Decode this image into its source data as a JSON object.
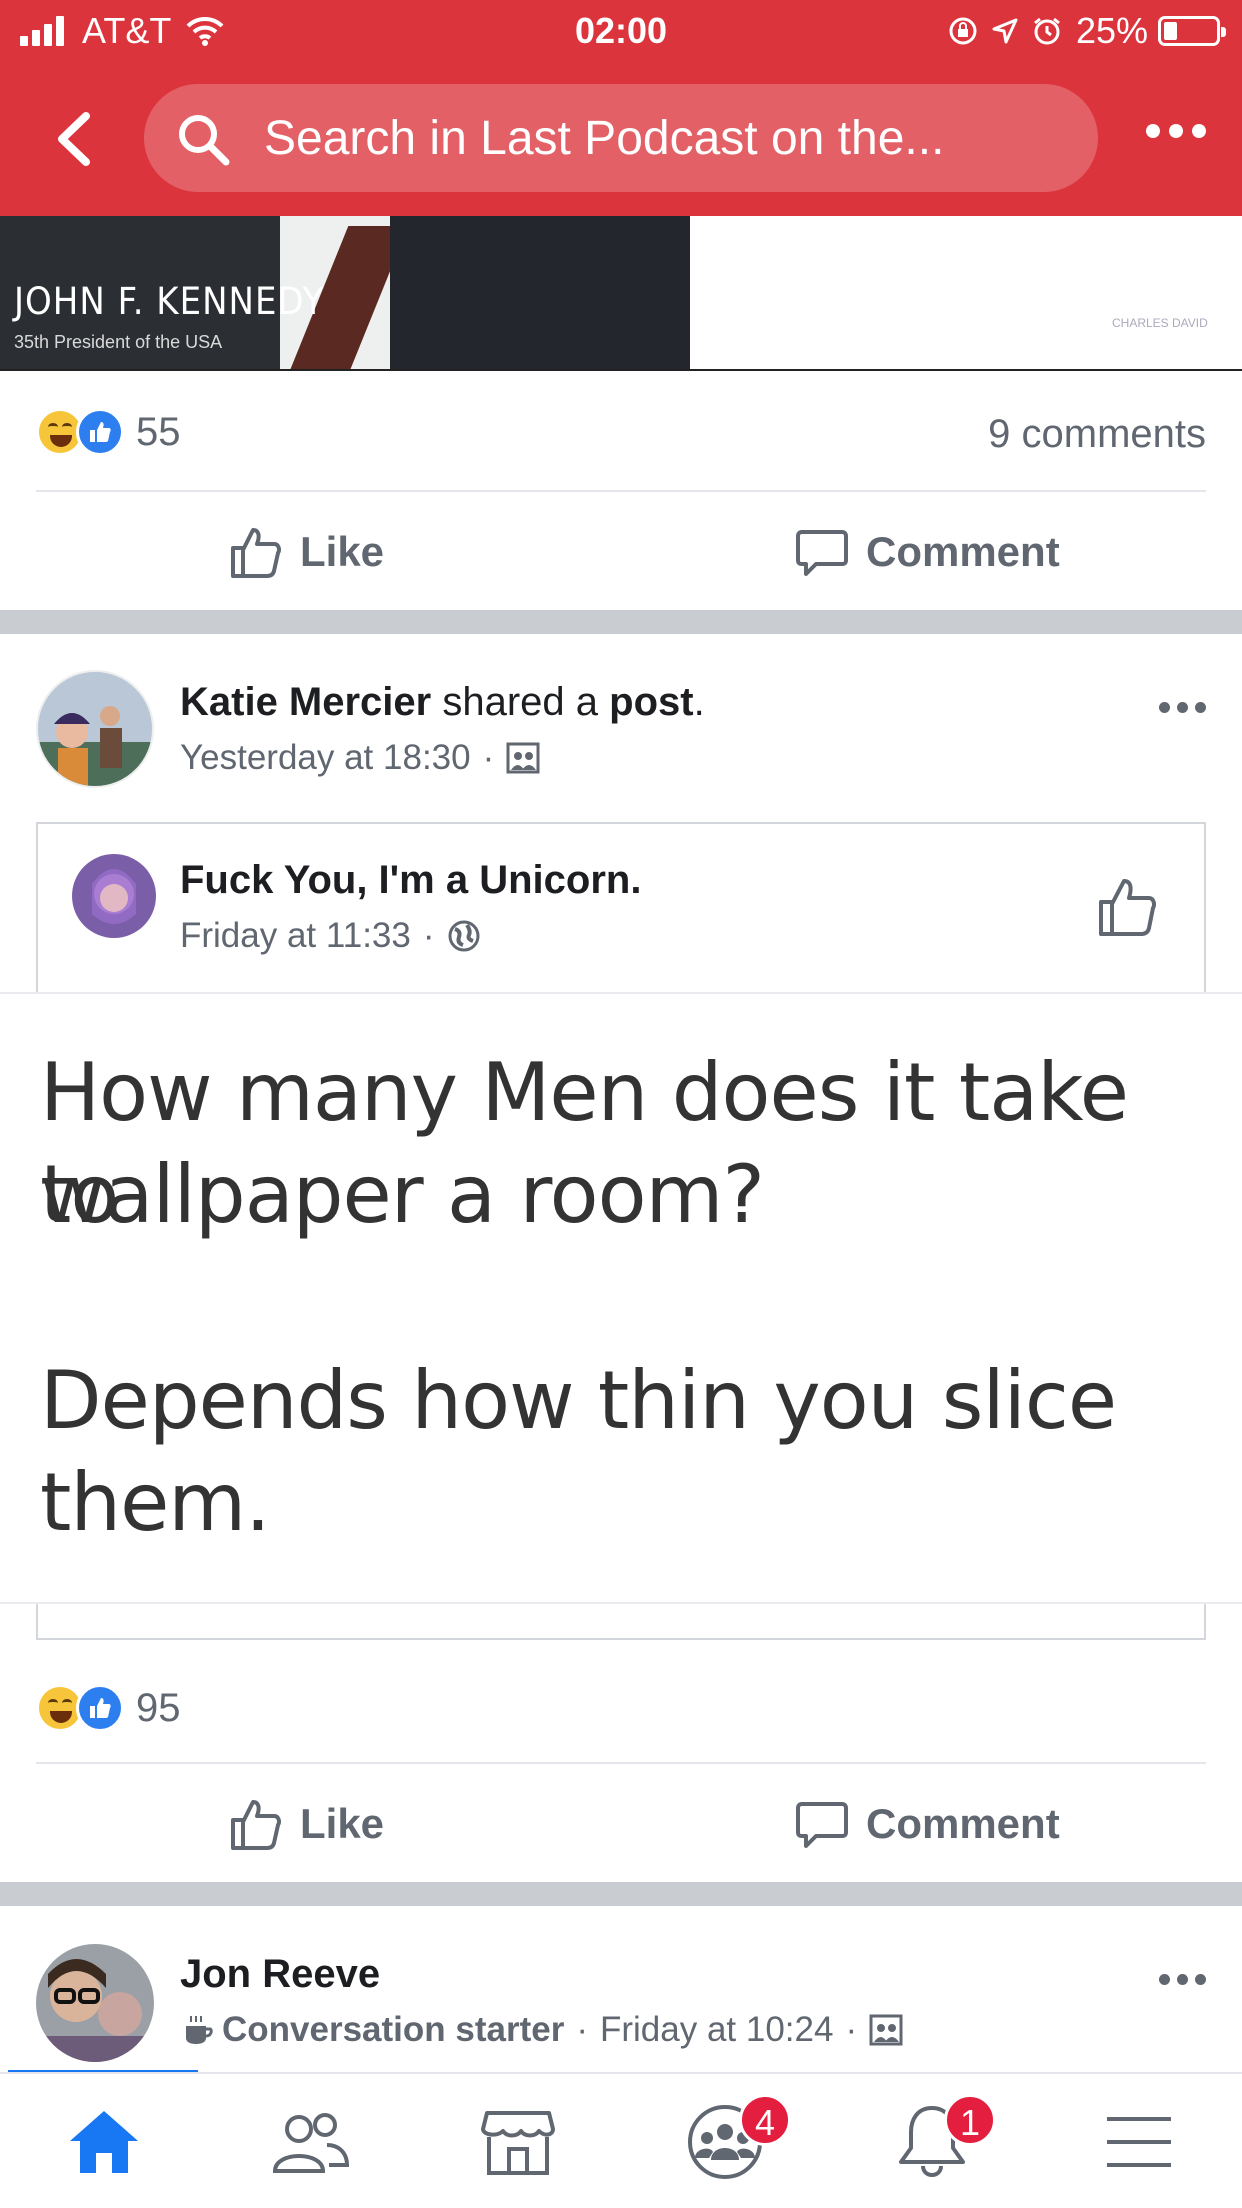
{
  "status_bar": {
    "carrier": "AT&T",
    "time": "02:00",
    "battery": "25%",
    "battery_level": 0.25
  },
  "header": {
    "search_placeholder": "Search in Last Podcast on the..."
  },
  "post1": {
    "image_title": "JOHN F. KENNEDY",
    "image_subtitle": "35th President of the USA",
    "image_credit": "CHARLES DAVID",
    "reaction_count": "55",
    "comments_label": "9 comments",
    "like_label": "Like",
    "comment_label": "Comment"
  },
  "post2": {
    "author": "Katie Mercier",
    "shared_text": "shared a",
    "shared_object": "post",
    "period": ".",
    "time": "Yesterday at 18:30",
    "meta_sep": "·",
    "original": {
      "page": "Fuck You, I'm a Unicorn.",
      "time": "Friday at 11:33"
    },
    "quote_line1": "How many Men does it take to",
    "quote_line2": "wallpaper a room?",
    "quote_line3": "Depends how thin you slice",
    "quote_line4": "them.",
    "reaction_count": "95",
    "like_label": "Like",
    "comment_label": "Comment"
  },
  "post3": {
    "author": "Jon Reeve",
    "badge": "Conversation starter",
    "time": "Friday at 10:24",
    "meta_sep": "·"
  },
  "tabbar": {
    "groups_badge": "4",
    "notifications_badge": "1",
    "accent": "#1877f2"
  },
  "colors": {
    "header_red": "#dc343c",
    "meta_grey": "#606770",
    "separator": "#c9ccd1"
  }
}
